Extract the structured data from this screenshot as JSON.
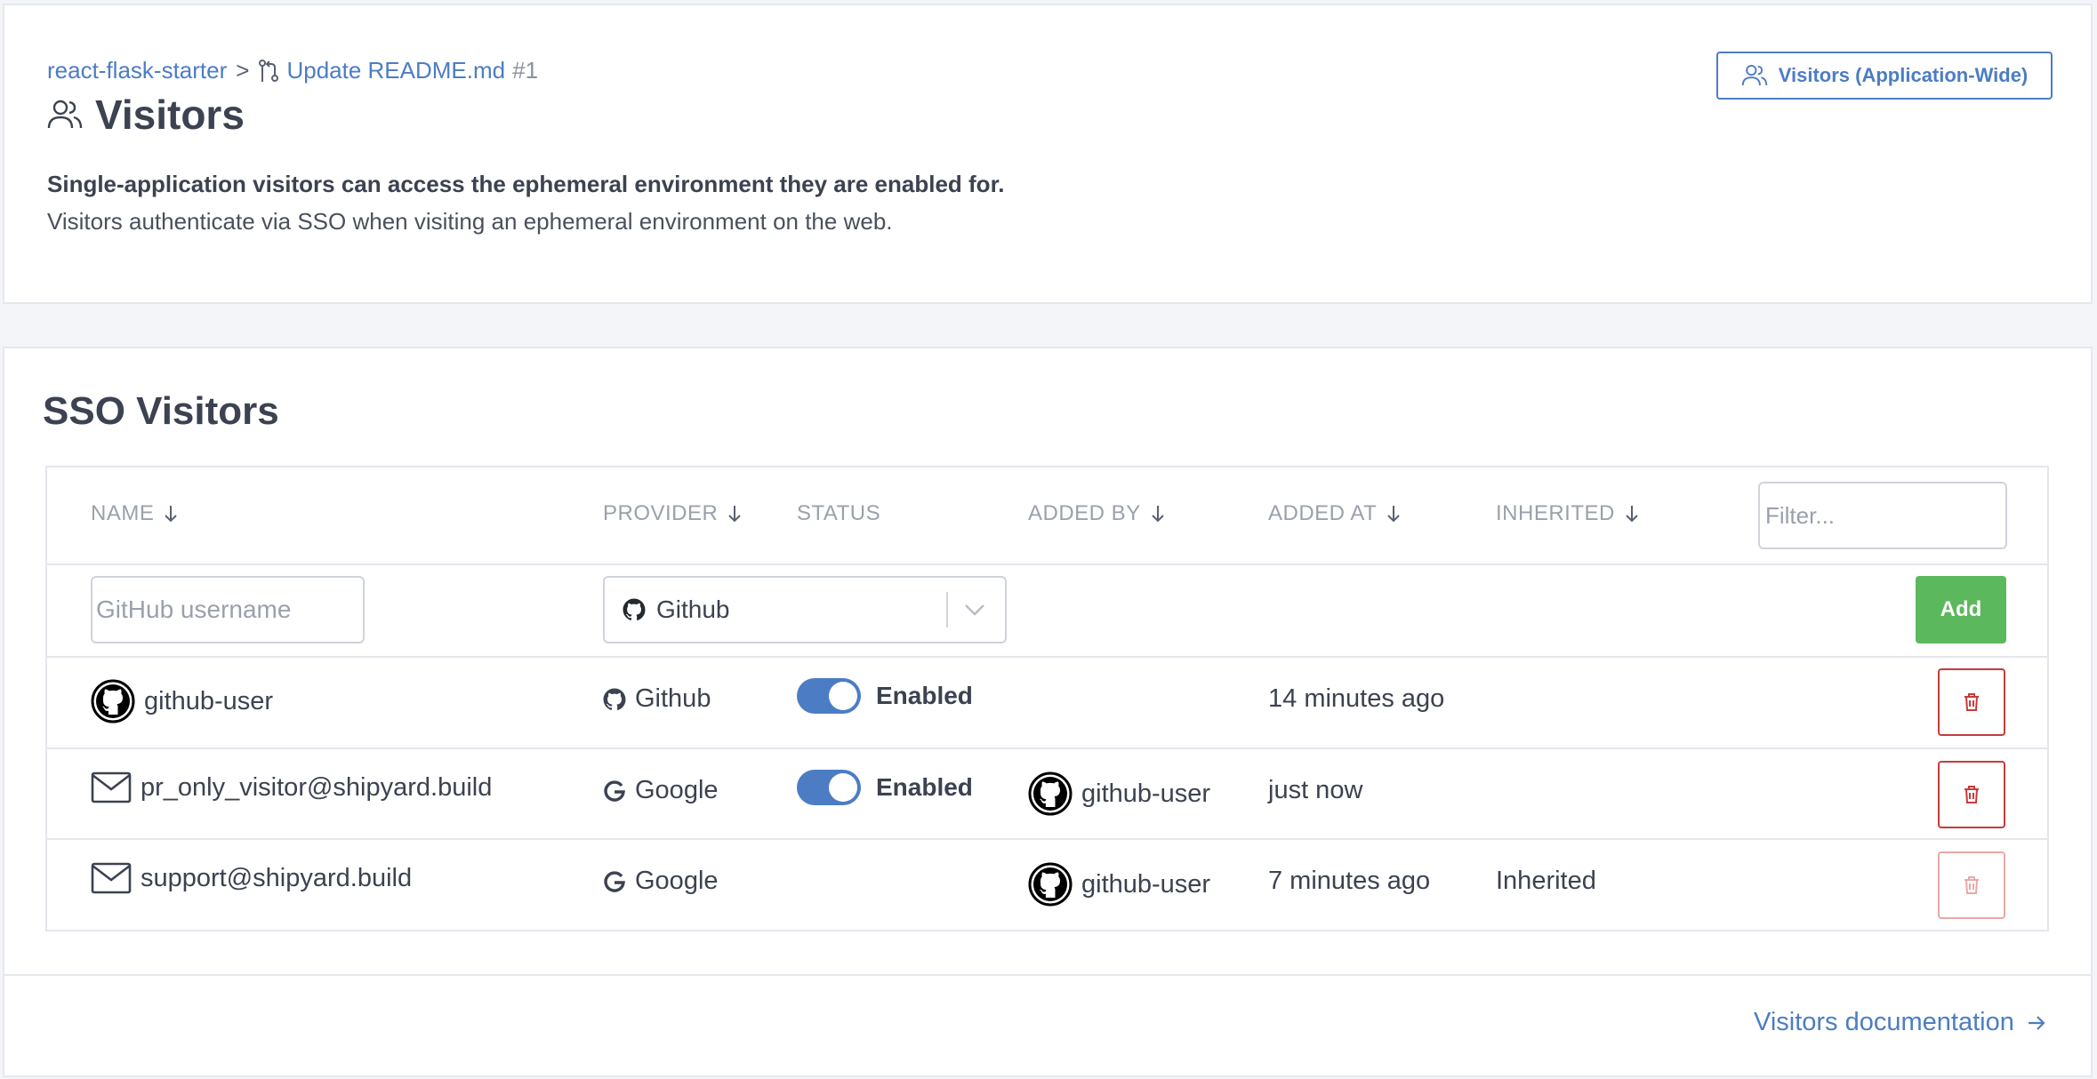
{
  "breadcrumb": {
    "repo": "react-flask-starter",
    "separator": ">",
    "pr_title": "Update README.md",
    "pr_number": "#1"
  },
  "header": {
    "title": "Visitors",
    "app_wide_button": "Visitors (Application-Wide)",
    "description_bold": "Single-application visitors can access the ephemeral environment they are enabled for.",
    "description": "Visitors authenticate via SSO when visiting an ephemeral environment on the web."
  },
  "sso": {
    "title": "SSO Visitors",
    "columns": {
      "name": "NAME",
      "provider": "PROVIDER",
      "status": "STATUS",
      "added_by": "ADDED BY",
      "added_at": "ADDED AT",
      "inherited": "INHERITED"
    },
    "filter_placeholder": "Filter...",
    "new_row": {
      "username_placeholder": "GitHub username",
      "provider_selected": "Github",
      "add_label": "Add"
    },
    "rows": [
      {
        "name": "github-user",
        "name_icon": "github-avatar-icon",
        "provider": "Github",
        "provider_icon": "github-icon",
        "status": "Enabled",
        "added_by": "",
        "added_at": "14 minutes ago",
        "inherited": ""
      },
      {
        "name": "pr_only_visitor@shipyard.build",
        "name_icon": "mail-icon",
        "provider": "Google",
        "provider_icon": "google-icon",
        "status": "Enabled",
        "added_by": "github-user",
        "added_at": "just now",
        "inherited": ""
      },
      {
        "name": "support@shipyard.build",
        "name_icon": "mail-icon",
        "provider": "Google",
        "provider_icon": "google-icon",
        "status": "",
        "added_by": "github-user",
        "added_at": "7 minutes ago",
        "inherited": "Inherited"
      }
    ]
  },
  "footer": {
    "docs_link": "Visitors documentation"
  },
  "colors": {
    "link": "#4c7dc4",
    "toggle_on": "#4c7dc4",
    "add_button": "#5cb85c",
    "delete_border": "#c83a3a"
  }
}
